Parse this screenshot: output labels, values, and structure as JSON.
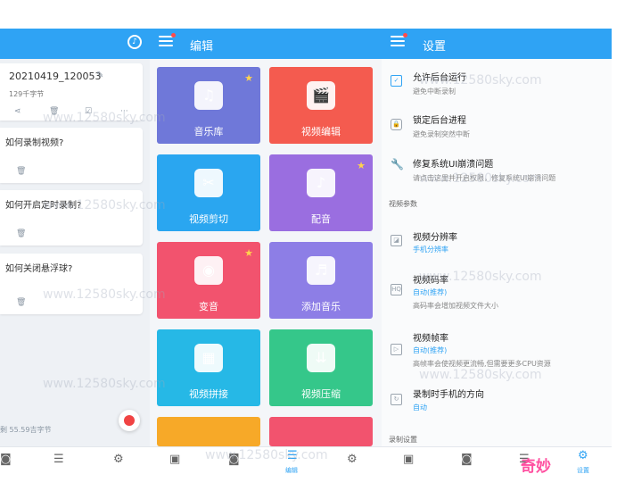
{
  "header": {
    "mid_title": "编辑",
    "right_title": "设置"
  },
  "records": [
    {
      "title": "20210419_120053",
      "subtitle": "129千字节"
    },
    {
      "title": "如何录制视频?"
    },
    {
      "title": "如何开启定时录制?"
    },
    {
      "title": "如何关闭悬浮球?"
    }
  ],
  "storage_text": "剩 55.59吉字节",
  "tiles": [
    {
      "label": "音乐库",
      "color": "#6f78d9",
      "icon": "music-library-icon"
    },
    {
      "label": "视频编辑",
      "color": "#f45b4f",
      "icon": "video-edit-icon"
    },
    {
      "label": "视频剪切",
      "color": "#2aa6f0",
      "icon": "video-cut-icon"
    },
    {
      "label": "配音",
      "color": "#9a6ee0",
      "icon": "dubbing-icon"
    },
    {
      "label": "变音",
      "color": "#f2536e",
      "icon": "voice-change-icon"
    },
    {
      "label": "添加音乐",
      "color": "#8d7ee6",
      "icon": "add-music-icon"
    },
    {
      "label": "视频拼接",
      "color": "#26b8e6",
      "icon": "video-merge-icon"
    },
    {
      "label": "视频压缩",
      "color": "#35c78a",
      "icon": "video-compress-icon"
    }
  ],
  "settings": {
    "s1_title": "允许后台运行",
    "s1_sub": "避免中断录制",
    "s2_title": "锁定后台进程",
    "s2_sub": "避免录制突然中断",
    "s3_title": "修复系统UI崩溃问题",
    "s3_sub": "请点击这里并开启权限，修复系统UI崩溃问题",
    "section_video": "视频参数",
    "s4_title": "视频分辨率",
    "s4_val": "手机分辨率",
    "s5_title": "视频码率",
    "s5_val": "自动(推荐)",
    "s5_sub": "高码率会增加视频文件大小",
    "s6_title": "视频帧率",
    "s6_val": "自动(推荐)",
    "s6_sub": "高帧率会使视频更流畅,但需要更多CPU资源",
    "s7_title": "录制时手机的方向",
    "s7_val": "自动",
    "section_record": "录制设置"
  },
  "nav": {
    "edit_caption": "编辑",
    "settings_caption": "设置"
  },
  "watermark": "www.12580sky.com",
  "brand": "奇妙",
  "colors": {
    "accent": "#2fa3f4",
    "record": "#f04343"
  }
}
